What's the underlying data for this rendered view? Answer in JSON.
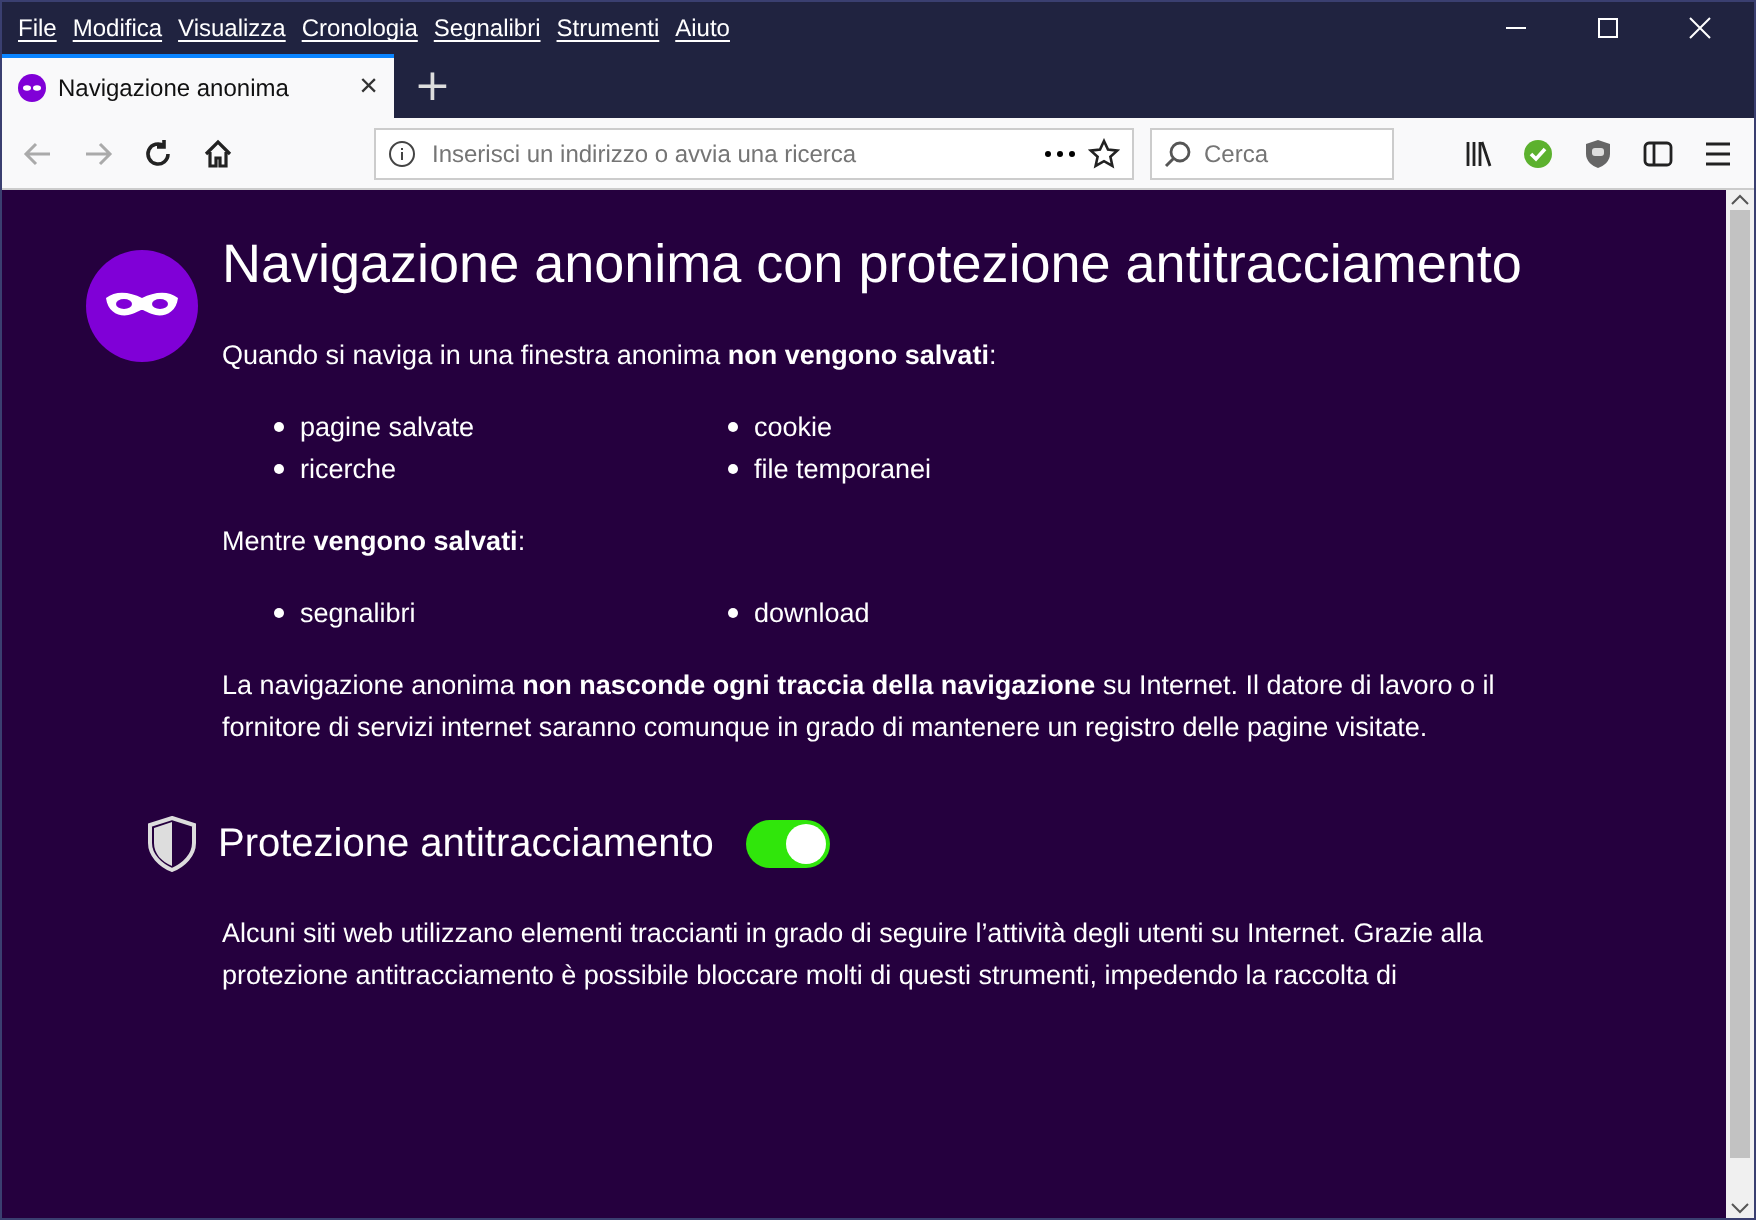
{
  "menu": [
    "File",
    "Modifica",
    "Visualizza",
    "Cronologia",
    "Segnalibri",
    "Strumenti",
    "Aiuto"
  ],
  "tabs": [
    {
      "label": "Navigazione anonima",
      "close": "×",
      "selected": true
    }
  ],
  "new_tab": "+",
  "address_bar": {
    "placeholder": "Inserisci un indirizzo o avvia una ricerca"
  },
  "search": {
    "placeholder": "Cerca"
  },
  "page": {
    "title": "Navigazione anonima con protezione antitracciamento",
    "not_saved_intro": "Quando si naviga in una finestra anonima **non vengono salvati**:",
    "not_saved": [
      "pagine salvate",
      "cookie",
      "ricerche",
      "file temporanei"
    ],
    "saved_intro": "Mentre **vengono salvati**:",
    "saved": [
      "segnalibri",
      "download"
    ],
    "notice": "La navigazione anonima **non nasconde ogni traccia della navigazione** su Internet. Il datore di lavoro o il fornitore di servizi internet saranno comunque in grado di mantenere un registro delle pagine visitate.",
    "tracking": {
      "title": "Protezione antitracciamento",
      "on": true,
      "text": "Alcuni siti web utilizzano elementi traccianti in grado di seguire l’attività degli utenti su Internet. Grazie alla protezione antitracciamento è possibile bloccare molti di questi strumenti, impedendo la raccolta di"
    }
  }
}
